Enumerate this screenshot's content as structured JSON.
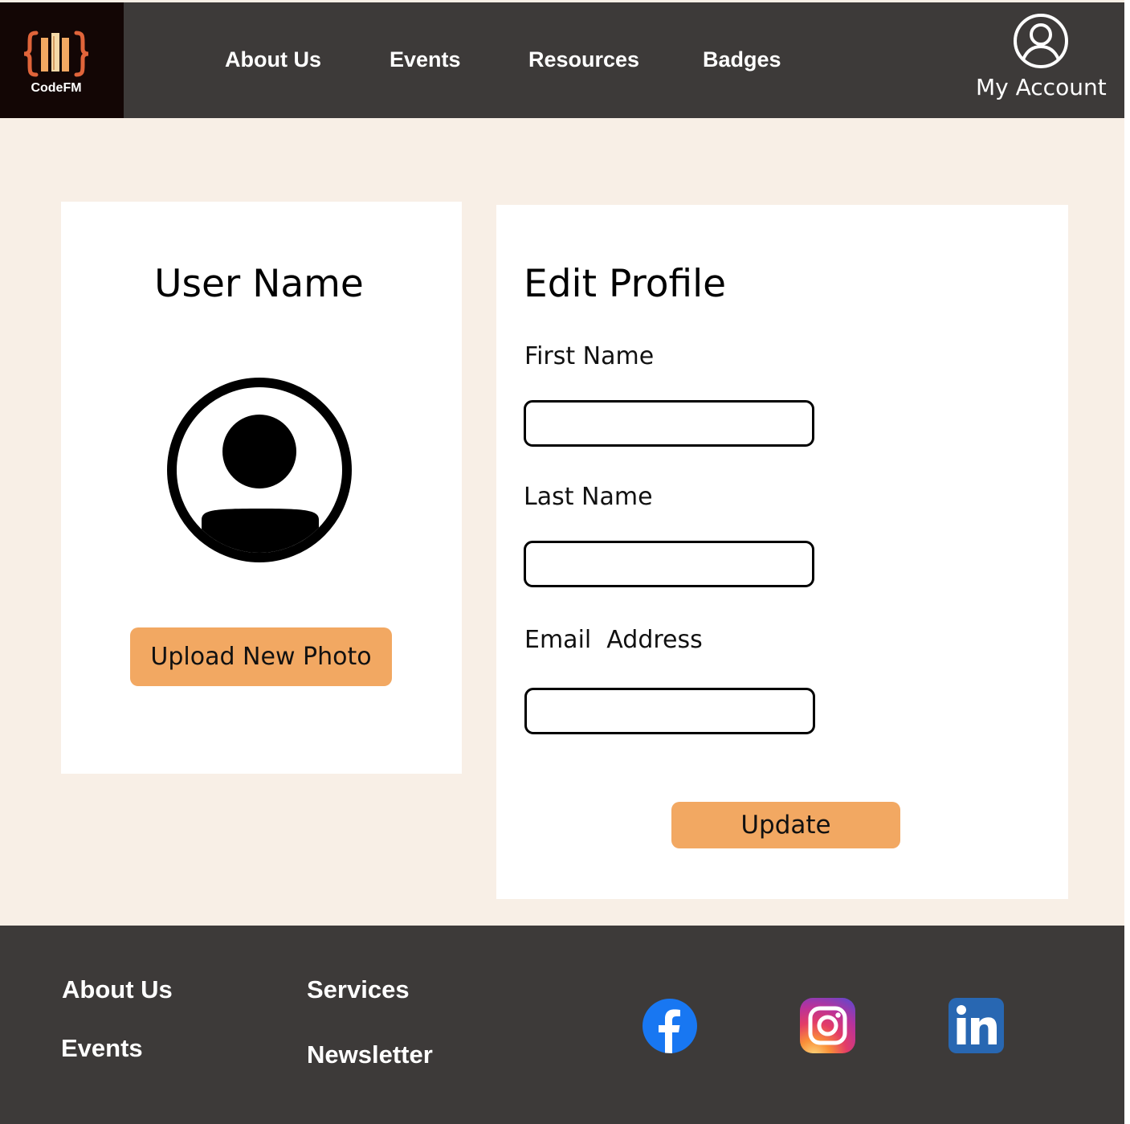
{
  "header": {
    "logo_text": "CodeFM",
    "nav": [
      {
        "label": "About Us"
      },
      {
        "label": "Events"
      },
      {
        "label": "Resources"
      },
      {
        "label": "Badges"
      }
    ],
    "account_label": "My Account",
    "account_icon": "user-circle-icon"
  },
  "profile_card": {
    "user_name": "User Name",
    "avatar_icon": "user-avatar-icon",
    "upload_label": "Upload New Photo"
  },
  "edit_form": {
    "title": "Edit Profile",
    "fields": [
      {
        "label": "First Name",
        "value": ""
      },
      {
        "label": "Last Name",
        "value": ""
      },
      {
        "label": "Email  Address",
        "value": ""
      }
    ],
    "update_label": "Update"
  },
  "footer": {
    "links": [
      {
        "label": "About Us"
      },
      {
        "label": "Events"
      },
      {
        "label": "Services"
      },
      {
        "label": "Newsletter"
      }
    ],
    "social": [
      {
        "icon": "facebook-icon"
      },
      {
        "icon": "instagram-icon"
      },
      {
        "icon": "linkedin-icon"
      }
    ]
  },
  "colors": {
    "header_bg": "#3d3a39",
    "page_bg": "#f8efe6",
    "accent": "#f2a862",
    "logo_bg": "#130605",
    "logo_brace": "#e0643a"
  }
}
